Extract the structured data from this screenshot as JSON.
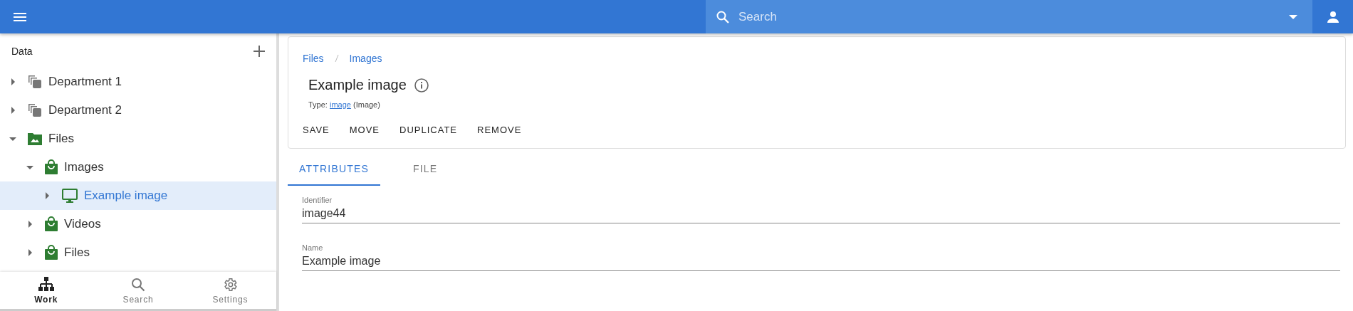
{
  "search": {
    "placeholder": "Search"
  },
  "sidebar": {
    "title": "Data",
    "tree": [
      {
        "label": "Department 1",
        "kind": "stack",
        "expanded": false,
        "selected": false
      },
      {
        "label": "Department 2",
        "kind": "stack",
        "expanded": false,
        "selected": false
      },
      {
        "label": "Files",
        "kind": "folder",
        "expanded": true,
        "selected": false,
        "children": [
          {
            "label": "Images",
            "kind": "bag",
            "expanded": true,
            "selected": false,
            "children": [
              {
                "label": "Example image",
                "kind": "monitor",
                "expanded": false,
                "selected": true
              }
            ]
          },
          {
            "label": "Videos",
            "kind": "bag",
            "expanded": false,
            "selected": false
          },
          {
            "label": "Files",
            "kind": "bag",
            "expanded": false,
            "selected": false
          }
        ]
      }
    ],
    "nav": [
      {
        "label": "Work",
        "kind": "tree",
        "selected": true
      },
      {
        "label": "Search",
        "kind": "search",
        "selected": false
      },
      {
        "label": "Settings",
        "kind": "gear",
        "selected": false
      }
    ]
  },
  "breadcrumb": [
    "Files",
    "Images"
  ],
  "title": "Example image",
  "type_line": {
    "prefix": "Type:",
    "link": "image",
    "suffix": "(Image)"
  },
  "actions": [
    "SAVE",
    "MOVE",
    "DUPLICATE",
    "REMOVE"
  ],
  "tabs": [
    {
      "label": "ATTRIBUTES",
      "selected": true
    },
    {
      "label": "FILE",
      "selected": false
    }
  ],
  "fields": [
    {
      "label": "Identifier",
      "value": "image44"
    },
    {
      "label": "Name",
      "value": "Example image"
    }
  ]
}
